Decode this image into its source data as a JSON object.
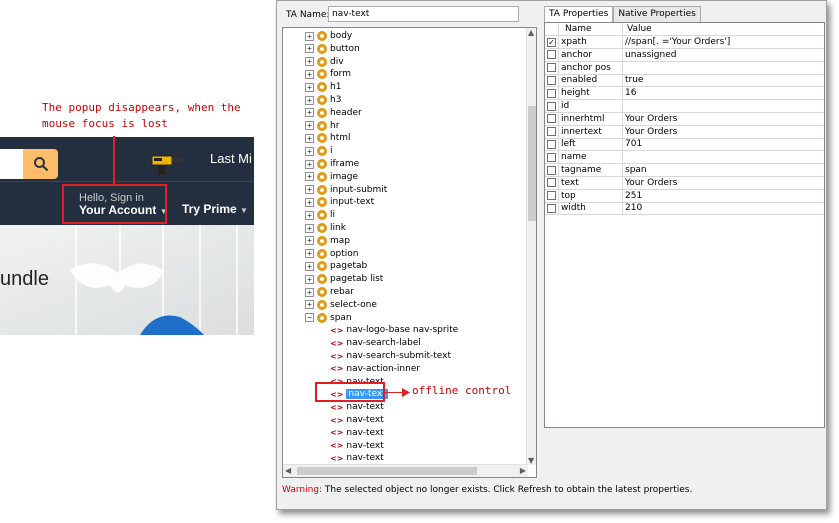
{
  "annotation": {
    "popup_note": "The popup disappears, when the mouse focus is lost",
    "offline_note": "offline control"
  },
  "amazon": {
    "last_mi": "Last Mi",
    "hello": "Hello, Sign in",
    "account": "Your Account",
    "try_prime": "Try Prime",
    "bundle": "undle",
    "accent": "#febd69",
    "header_bg": "#232f3e"
  },
  "window": {
    "ta_name_label": "TA Name:",
    "ta_name_value": "nav-text",
    "tabs": [
      "TA Properties",
      "Native Properties"
    ],
    "tree_nodes": [
      "body",
      "button",
      "div",
      "form",
      "h1",
      "h3",
      "header",
      "hr",
      "html",
      "i",
      "iframe",
      "image",
      "input-submit",
      "input-text",
      "li",
      "link",
      "map",
      "option",
      "pagetab",
      "pagetab list",
      "rebar",
      "select-one",
      "span"
    ],
    "span_children": [
      "nav-logo-base nav-sprite",
      "nav-search-label",
      "nav-search-submit-text",
      "nav-action-inner",
      "nav-text",
      "nav-text",
      "nav-text",
      "nav-text",
      "nav-text",
      "nav-text",
      "nav-text"
    ],
    "selected_index": 5,
    "columns": [
      "Name",
      "Value"
    ],
    "properties": [
      {
        "name": "xpath",
        "value": "//span[. ='Your Orders']",
        "checked": true
      },
      {
        "name": "anchor",
        "value": "unassigned",
        "checked": false
      },
      {
        "name": "anchor pos",
        "value": "",
        "checked": false
      },
      {
        "name": "enabled",
        "value": "true",
        "checked": false
      },
      {
        "name": "height",
        "value": "16",
        "checked": false
      },
      {
        "name": "id",
        "value": "",
        "checked": false
      },
      {
        "name": "innerhtml",
        "value": "Your Orders",
        "checked": false
      },
      {
        "name": "innertext",
        "value": "Your Orders",
        "checked": false
      },
      {
        "name": "left",
        "value": "701",
        "checked": false
      },
      {
        "name": "name",
        "value": "",
        "checked": false
      },
      {
        "name": "tagname",
        "value": "span",
        "checked": false
      },
      {
        "name": "text",
        "value": "Your Orders",
        "checked": false
      },
      {
        "name": "top",
        "value": "251",
        "checked": false
      },
      {
        "name": "width",
        "value": "210",
        "checked": false
      }
    ],
    "status_warning": "Warning:",
    "status_text": "The selected object no longer exists. Click Refresh to obtain the latest properties."
  }
}
